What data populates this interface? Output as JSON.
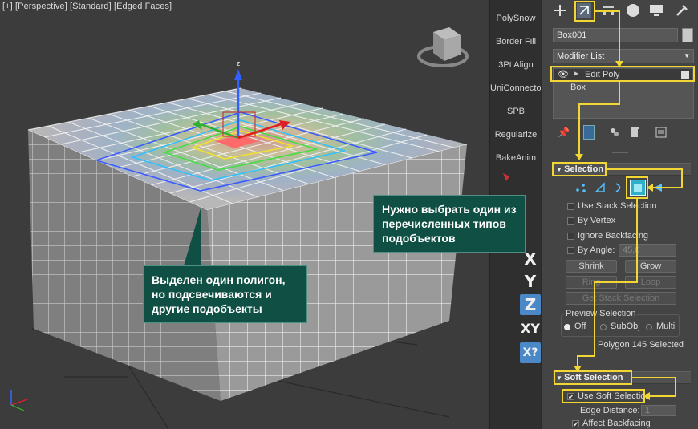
{
  "viewport": {
    "label": "[+] [Perspective] [Standard] [Edged Faces]",
    "gizmo_axis_z": "z"
  },
  "strip": {
    "buttons": [
      "PolySnow",
      "Border Fill",
      "3Pt Align",
      "UniConnector",
      "SPB",
      "Regularize",
      "BakeAnim"
    ],
    "axis_buttons": [
      "X",
      "Y",
      "Z",
      "XY"
    ]
  },
  "panel": {
    "object_name": "Box001",
    "object_color": "#c9c9c9",
    "modifier_list_label": "Modifier List",
    "stack_items": [
      "Edit Poly",
      "Box"
    ],
    "selection": {
      "title": "Selection",
      "use_stack_selection": "Use Stack Selection",
      "by_vertex": "By Vertex",
      "ignore_backfacing": "Ignore Backfacing",
      "by_angle": "By Angle:",
      "by_angle_value": "45,0",
      "shrink": "Shrink",
      "grow": "Grow",
      "ring": "Ring",
      "loop": "Loop",
      "get_stack_selection": "Get Stack Selection",
      "preview_selection": "Preview Selection",
      "preview_options": [
        "Off",
        "SubObj",
        "Multi"
      ],
      "status": "Polygon 145 Selected"
    },
    "soft_selection": {
      "title": "Soft Selection",
      "use_soft_selection": "Use Soft Selection",
      "edge_distance": "Edge Distance:",
      "edge_distance_value": "1",
      "affect_backfacing": "Affect Backfacing"
    }
  },
  "callouts": {
    "left": "Выделен один полигон, но подсвечиваются и другие подобъекты",
    "right": "Нужно выбрать один из перечисленных типов подобъектов"
  },
  "colors": {
    "highlight": "#f2d633",
    "callout_bg": "#0f4f44",
    "selected_polygon": "#ff6a6a"
  }
}
